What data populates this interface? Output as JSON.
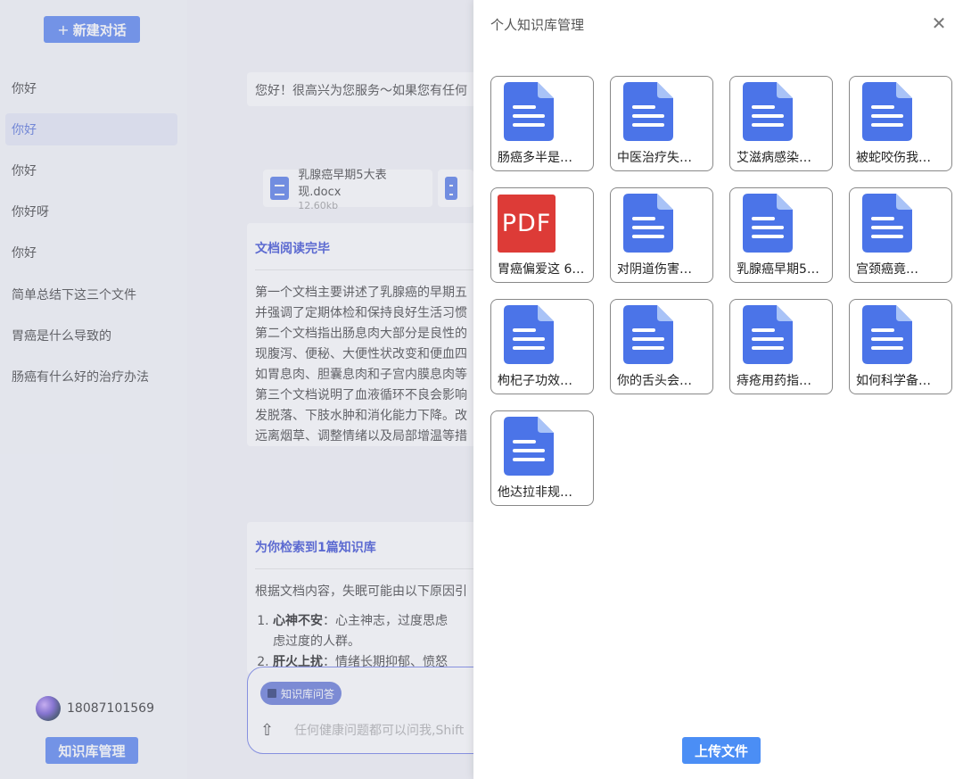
{
  "sidebar": {
    "new_chat_label": "新建对话",
    "history": [
      "你好",
      "你好",
      "你好",
      "你好呀",
      "你好",
      "简单总结下这三个文件",
      "胃癌是什么导致的",
      "肠癌有什么好的治疗办法"
    ],
    "active_index": 1,
    "user_phone": "18087101569",
    "kb_manage_label": "知识库管理"
  },
  "chat": {
    "greeting": "您好！很高兴为您服务～如果您有任何",
    "files": [
      {
        "name": "乳腺癌早期5大表现.docx",
        "size": "12.60kb"
      }
    ],
    "doc_read_title": "文档阅读完毕",
    "doc_read_lines": [
      "第一个文档主要讲述了乳腺癌的早期五",
      "并强调了定期体检和保持良好生活习惯",
      "第二个文档指出肠息肉大部分是良性的",
      "现腹泻、便秘、大便性状改变和便血四",
      "如胃息肉、胆囊息肉和子宫内膜息肉等",
      "第三个文档说明了血液循环不良会影响",
      "发脱落、下肢水肿和消化能力下降。改",
      "远离烟草、调整情绪以及局部增温等措"
    ],
    "kb_title": "为你检索到1篇知识库",
    "kb_intro": "根据文档内容，失眠可能由以下原因引",
    "kb_items": [
      {
        "bold": "心神不安",
        "text": "：心主神志，过度思虑",
        "cont": "虑过度的人群。"
      },
      {
        "bold": "肝火上扰",
        "text": "：情绪长期抑郁、愤怒",
        "cont": ""
      }
    ],
    "kb_tag": "知识库问答",
    "input_placeholder": "任何健康问题都可以问我,Shift"
  },
  "drawer": {
    "title": "个人知识库管理",
    "close_icon": "close-icon",
    "files": [
      {
        "name": "肠癌多半是…",
        "type": "doc"
      },
      {
        "name": "中医治疗失…",
        "type": "doc"
      },
      {
        "name": "艾滋病感染…",
        "type": "doc"
      },
      {
        "name": "被蛇咬伤我…",
        "type": "doc"
      },
      {
        "name": "胃癌偏爱这 6…",
        "type": "pdf",
        "badge": "PDF"
      },
      {
        "name": "对阴道伤害…",
        "type": "doc"
      },
      {
        "name": "乳腺癌早期5…",
        "type": "doc"
      },
      {
        "name": "宫颈癌竟…",
        "type": "doc"
      },
      {
        "name": "枸杞子功效…",
        "type": "doc"
      },
      {
        "name": "你的舌头会…",
        "type": "doc"
      },
      {
        "name": "痔疮用药指…",
        "type": "doc"
      },
      {
        "name": "如何科学备…",
        "type": "doc"
      },
      {
        "name": "他达拉非规…",
        "type": "doc"
      }
    ],
    "upload_label": "上传文件"
  },
  "colors": {
    "primary": "#4e7df0",
    "drawer_upload": "#4b8ef5",
    "doc_icon": "#4b74e8",
    "pdf_icon": "#dd3b37",
    "title_blue": "#2c3fd1"
  }
}
